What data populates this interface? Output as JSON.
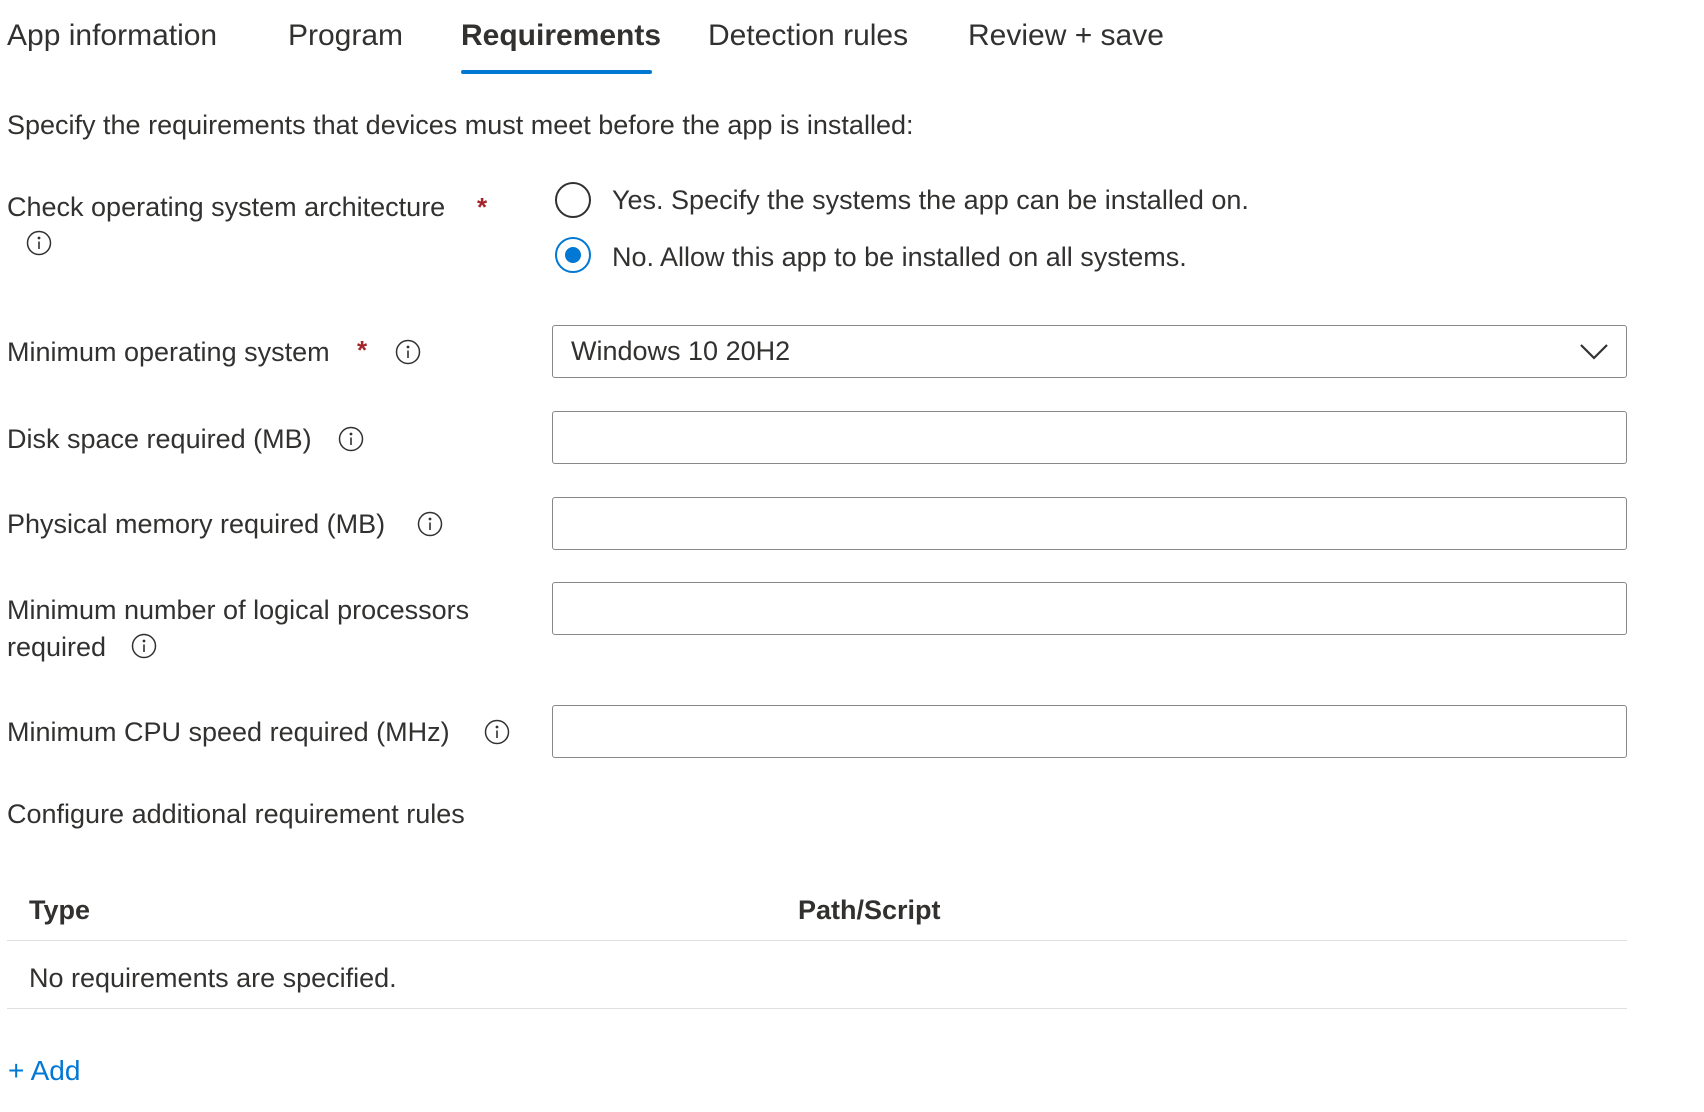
{
  "tabs": [
    {
      "label": "App information",
      "active": false
    },
    {
      "label": "Program",
      "active": false
    },
    {
      "label": "Requirements",
      "active": true
    },
    {
      "label": "Detection rules",
      "active": false
    },
    {
      "label": "Review + save",
      "active": false
    }
  ],
  "intro": "Specify the requirements that devices must meet before the app is installed:",
  "architecture": {
    "label": "Check operating system architecture",
    "required_mark": "*",
    "options": [
      {
        "label": "Yes. Specify the systems the app can be installed on.",
        "checked": false
      },
      {
        "label": "No. Allow this app to be installed on all systems.",
        "checked": true
      }
    ]
  },
  "min_os": {
    "label": "Minimum operating system",
    "required_mark": "*",
    "value": "Windows 10 20H2"
  },
  "disk_space": {
    "label": "Disk space required (MB)",
    "value": ""
  },
  "physical_memory": {
    "label": "Physical memory required (MB)",
    "value": ""
  },
  "logical_processors": {
    "label_line1": "Minimum number of logical processors",
    "label_line2": "required",
    "value": ""
  },
  "cpu_speed": {
    "label": "Minimum CPU speed required (MHz)",
    "value": ""
  },
  "additional_rules": {
    "heading": "Configure additional requirement rules",
    "columns": [
      "Type",
      "Path/Script"
    ],
    "empty_text": "No requirements are specified.",
    "add_label": "+ Add"
  },
  "colors": {
    "accent": "#0078d4",
    "required": "#a4262c",
    "text": "#323130",
    "border": "#8a8886"
  }
}
